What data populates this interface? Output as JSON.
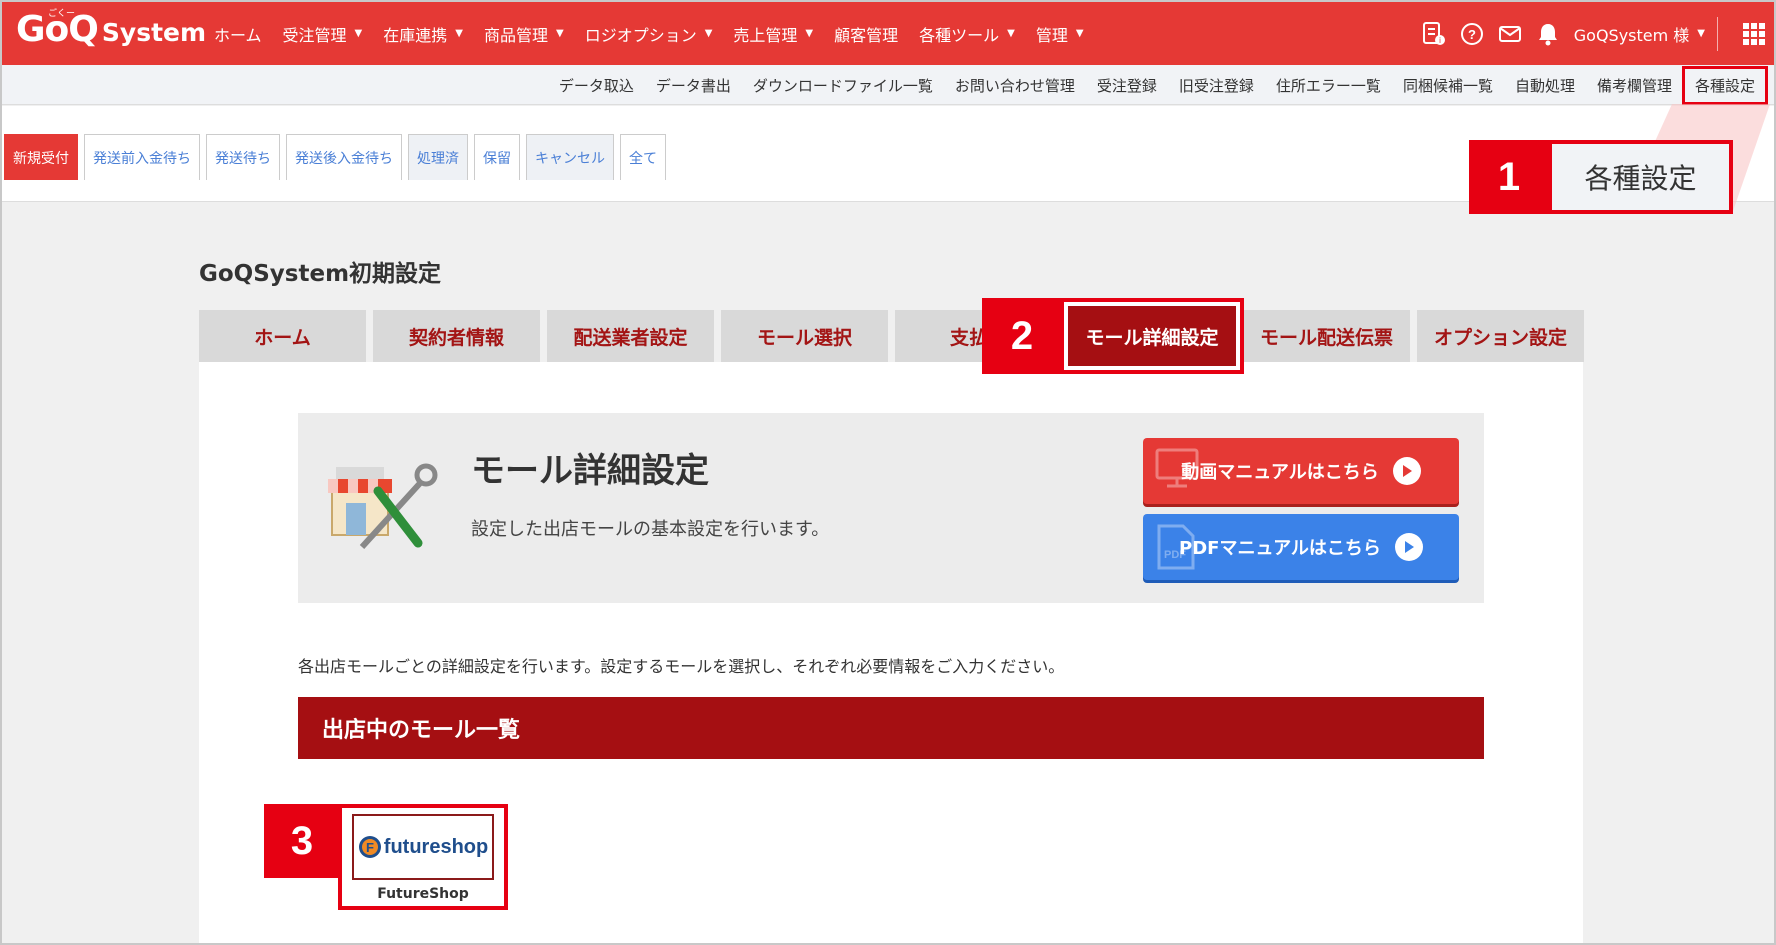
{
  "brand": {
    "logo_main": "GoQ",
    "logo_sub": "System",
    "logo_ruby": "ごくー"
  },
  "main_nav": [
    {
      "label": "ホーム",
      "caret": false
    },
    {
      "label": "受注管理",
      "caret": true
    },
    {
      "label": "在庫連携",
      "caret": true
    },
    {
      "label": "商品管理",
      "caret": true
    },
    {
      "label": "ロジオプション",
      "caret": true
    },
    {
      "label": "売上管理",
      "caret": true
    },
    {
      "label": "顧客管理",
      "caret": false
    },
    {
      "label": "各種ツール",
      "caret": true
    },
    {
      "label": "管理",
      "caret": true
    }
  ],
  "user": {
    "name": "GoQSystem 様"
  },
  "sub_nav": [
    "データ取込",
    "データ書出",
    "ダウンロードファイル一覧",
    "お問い合わせ管理",
    "受注登録",
    "旧受注登録",
    "住所エラー一覧",
    "同梱候補一覧",
    "自動処理",
    "備考欄管理",
    "各種設定"
  ],
  "status_tabs": [
    {
      "label": "新規受付",
      "state": "current"
    },
    {
      "label": "発送前入金待ち",
      "state": "normal"
    },
    {
      "label": "発送待ち",
      "state": "normal"
    },
    {
      "label": "発送後入金待ち",
      "state": "normal"
    },
    {
      "label": "処理済",
      "state": "muted"
    },
    {
      "label": "保留",
      "state": "normal"
    },
    {
      "label": "キャンセル",
      "state": "muted"
    },
    {
      "label": "全て",
      "state": "normal"
    }
  ],
  "callouts": {
    "one": "1",
    "one_label": "各種設定",
    "two": "2",
    "three": "3"
  },
  "page_title": "GoQSystem初期設定",
  "settings_tabs": [
    "ホーム",
    "契約者情報",
    "配送業者設定",
    "モール選択",
    "支払い",
    "モール詳細設定",
    "モール配送伝票",
    "オプション設定"
  ],
  "hero": {
    "title": "モール詳細設定",
    "desc": "設定した出店モールの基本設定を行います。",
    "video_btn": "動画マニュアルはこちら",
    "pdf_btn": "PDFマニュアルはこちら",
    "pdf_ghost": "PDF"
  },
  "instruction": "各出店モールごとの詳細設定を行います。設定するモールを選択し、それぞれ必要情報をご入力ください。",
  "mall_list_header": "出店中のモール一覧",
  "mall": {
    "logo_text": "futureshop",
    "logo_letter": "F",
    "name": "FutureShop"
  },
  "colors": {
    "brand_red": "#e53935",
    "dark_red": "#a50f12",
    "callout_red": "#e60012",
    "pdf_blue": "#3b82e8"
  }
}
